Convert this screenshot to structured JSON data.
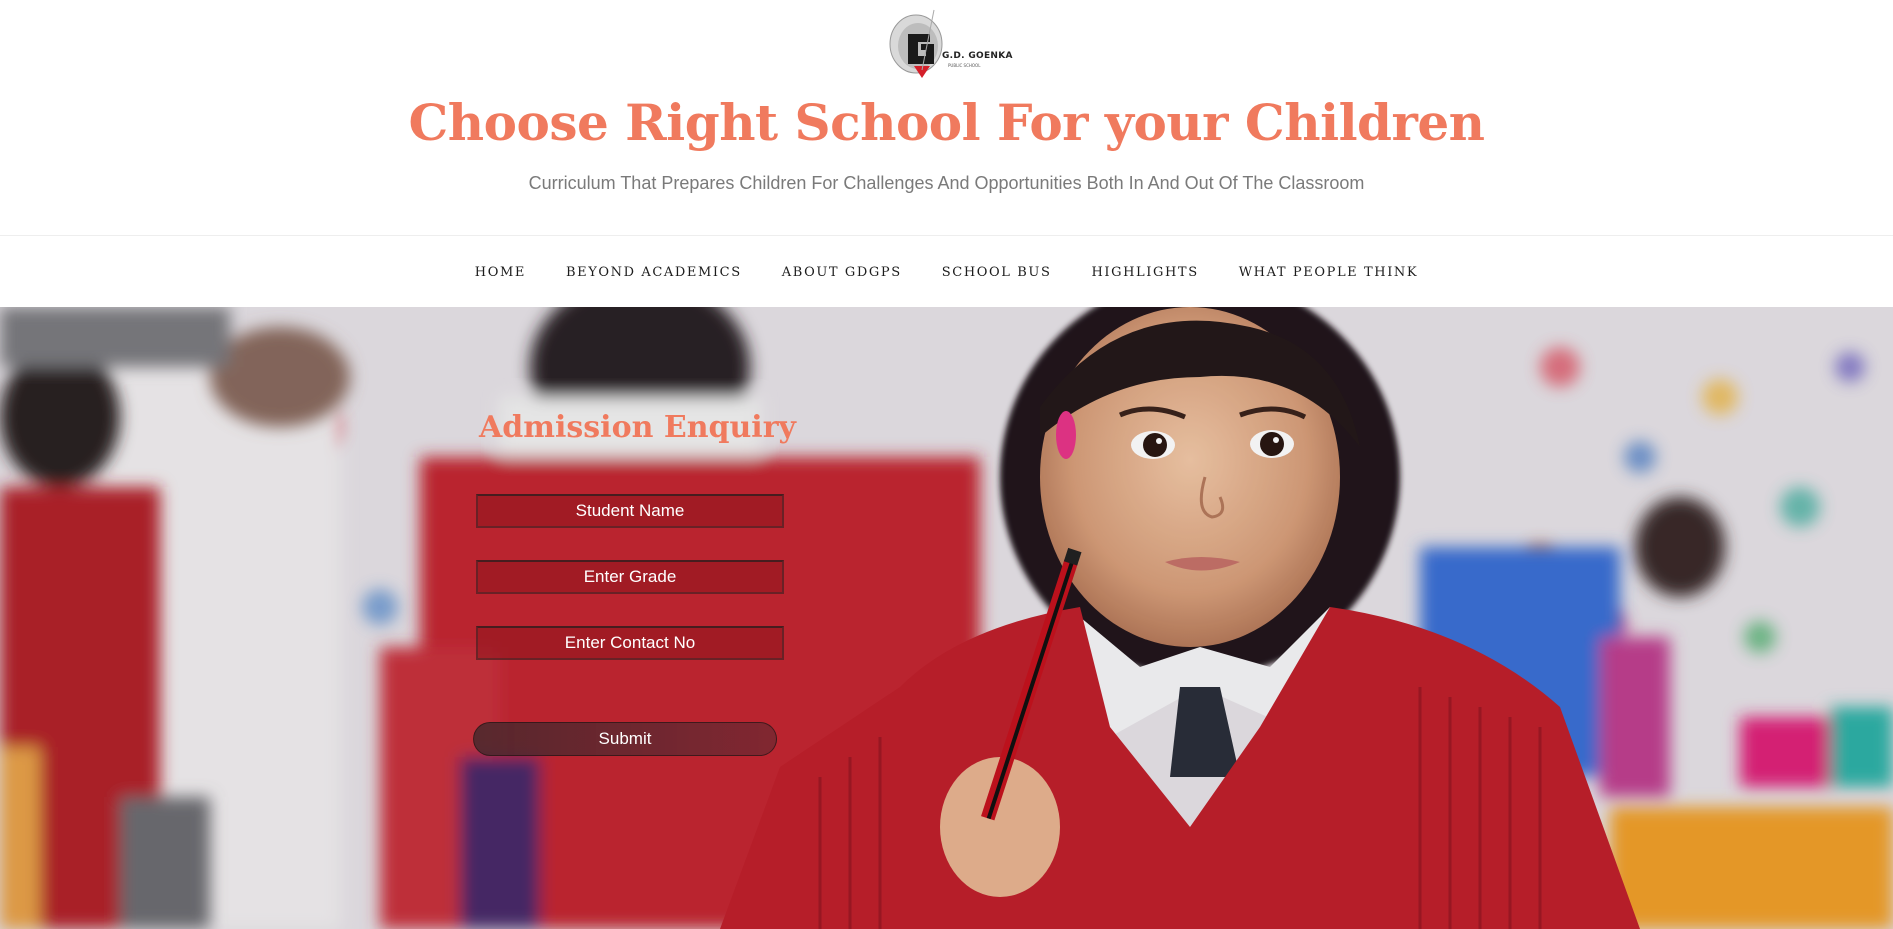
{
  "header": {
    "logo_text": "G.D. GOENKA",
    "logo_subtext": "PUBLIC SCHOOL",
    "title": "Choose Right School For your Children",
    "tagline": "Curriculum That Prepares Children For Challenges And Opportunities Both In And Out Of The Classroom"
  },
  "nav": {
    "items": [
      {
        "label": "HOME"
      },
      {
        "label": "BEYOND ACADEMICS"
      },
      {
        "label": "ABOUT GDGPS"
      },
      {
        "label": "SCHOOL BUS"
      },
      {
        "label": "HIGHLIGHTS"
      },
      {
        "label": "WHAT PEOPLE THINK"
      }
    ]
  },
  "hero": {
    "image_alt": "Young student in red school sweater holding a pencil in a classroom",
    "form": {
      "title": "Admission Enquiry",
      "fields": {
        "student_name_placeholder": "Student Name",
        "grade_placeholder": "Enter Grade",
        "contact_placeholder": "Enter Contact No"
      },
      "submit_label": "Submit"
    }
  },
  "colors": {
    "accent": "#f07a5e",
    "tagline_text": "#7a7a7a",
    "nav_text": "#1c1c1c",
    "input_fill": "#8c141c"
  }
}
